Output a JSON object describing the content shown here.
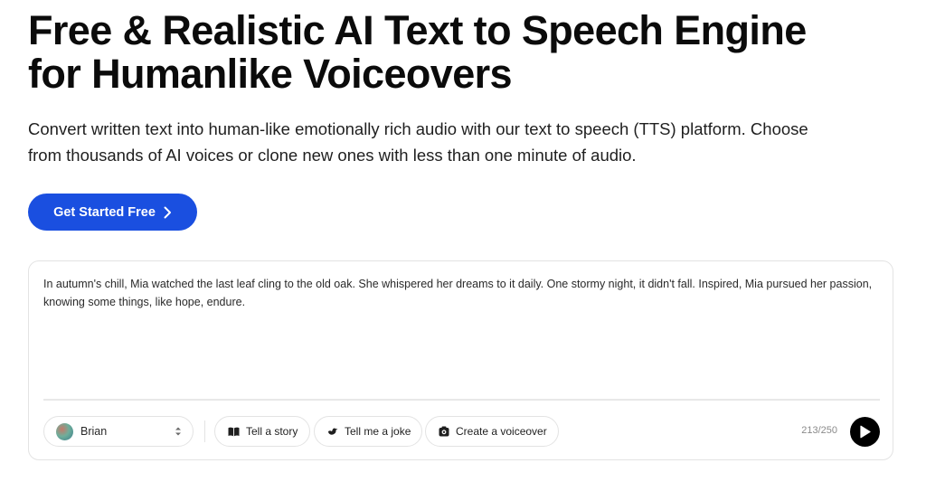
{
  "hero": {
    "title_line1": "Free & Realistic AI Text to Speech Engine",
    "title_line2": "for Humanlike Voiceovers",
    "subtitle_line1": "Convert written text into human-like emotionally rich audio with our text to speech (TTS) platform. Choose",
    "subtitle_line2": "from thousands of AI voices or clone new ones with less than one minute of audio.",
    "cta_label": "Get Started Free"
  },
  "editor": {
    "text": "In autumn's chill, Mia watched the last leaf cling to the old oak. She whispered her dreams to it daily. One stormy night, it didn't fall. Inspired, Mia pursued her passion, knowing some things, like hope, endure.",
    "voice": {
      "selected": "Brian",
      "avatar_icon": "voice-avatar"
    },
    "prompts": [
      {
        "label": "Tell a story",
        "icon": "book-icon"
      },
      {
        "label": "Tell me a joke",
        "icon": "duck-icon"
      },
      {
        "label": "Create a voiceover",
        "icon": "camera-icon"
      }
    ],
    "char_count": "213/250"
  },
  "colors": {
    "accent": "#1a4fe0",
    "text": "#0b0b0b",
    "border": "#e3e3e3",
    "muted": "#8a8a8a"
  }
}
